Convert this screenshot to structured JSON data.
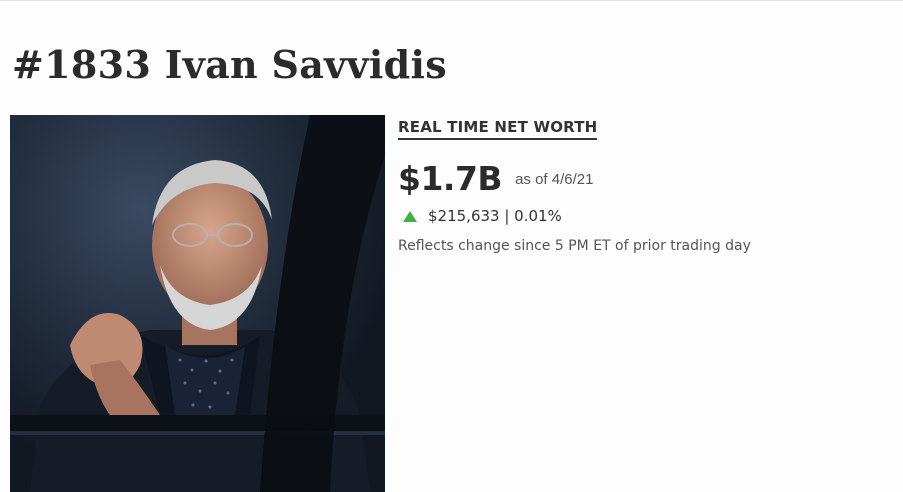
{
  "profile": {
    "title": "#1833 Ivan Savvidis"
  },
  "net_worth": {
    "heading": "REAL TIME NET WORTH",
    "value": "$1.7B",
    "as_of": "as of 4/6/21",
    "change": "$215,633 | 0.01%",
    "change_direction_icon": "triangle-up-icon",
    "change_color": "#3fb043",
    "note": "Reflects change since 5 PM ET of prior trading day"
  }
}
